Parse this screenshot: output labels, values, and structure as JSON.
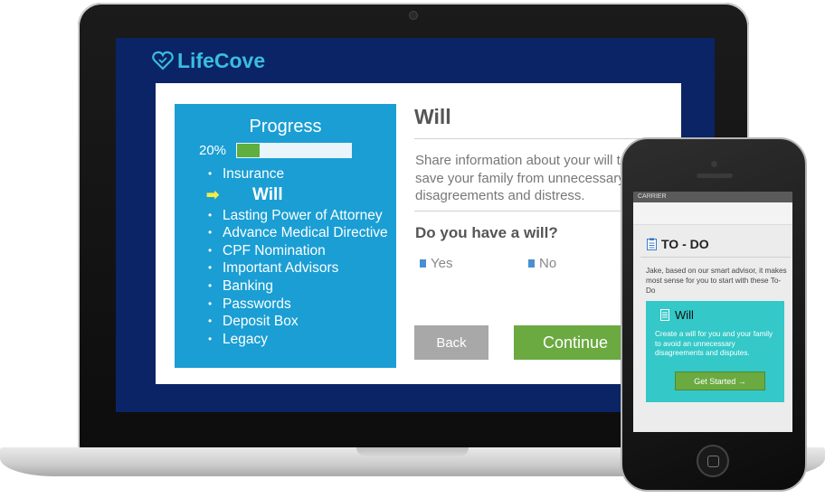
{
  "laptop": {
    "brand": {
      "name": "LifeCove",
      "icon": "heart-logo-icon",
      "color": "#39bde0"
    },
    "progress": {
      "title": "Progress",
      "percent_label": "20%",
      "percent_value": 0.2,
      "steps": [
        {
          "label": "Insurance",
          "marker": "•"
        },
        {
          "label": "Will",
          "marker": "➡"
        },
        {
          "label": "Lasting Power of Attorney",
          "marker": "•"
        },
        {
          "label": "Advance Medical Directive",
          "marker": "•"
        },
        {
          "label": "CPF Nomination",
          "marker": "•"
        },
        {
          "label": "Important Advisors",
          "marker": "•"
        },
        {
          "label": "Banking",
          "marker": "•"
        },
        {
          "label": "Passwords",
          "marker": "•"
        },
        {
          "label": "Deposit Box",
          "marker": "•"
        },
        {
          "label": "Legacy",
          "marker": "•"
        }
      ]
    },
    "main": {
      "title": "Will",
      "description_lines": [
        "Share information about your will to",
        "save your family from unnecessary",
        "disagreements and distress."
      ],
      "question": "Do you have a will?",
      "options": [
        "Yes",
        "No"
      ],
      "back_label": "Back",
      "continue_label": "Continue"
    },
    "colors": {
      "screen_bg": "#0a2465",
      "progress_bg": "#1a9ed4",
      "accent_green": "#6aaa40"
    }
  },
  "phone": {
    "carrier": "CARRIER",
    "todo": {
      "icon": "clipboard-icon",
      "title": "TO - DO",
      "advice": "Jake, based on our smart advisor, it makes most sense for you to start with these To-Do"
    },
    "card": {
      "icon": "document-icon",
      "title": "Will",
      "text": "Create a will for you and your family to avoid an unnecessary disagreements and disputes.",
      "button_label": "Get Started →",
      "color": "#34c8c8"
    }
  }
}
